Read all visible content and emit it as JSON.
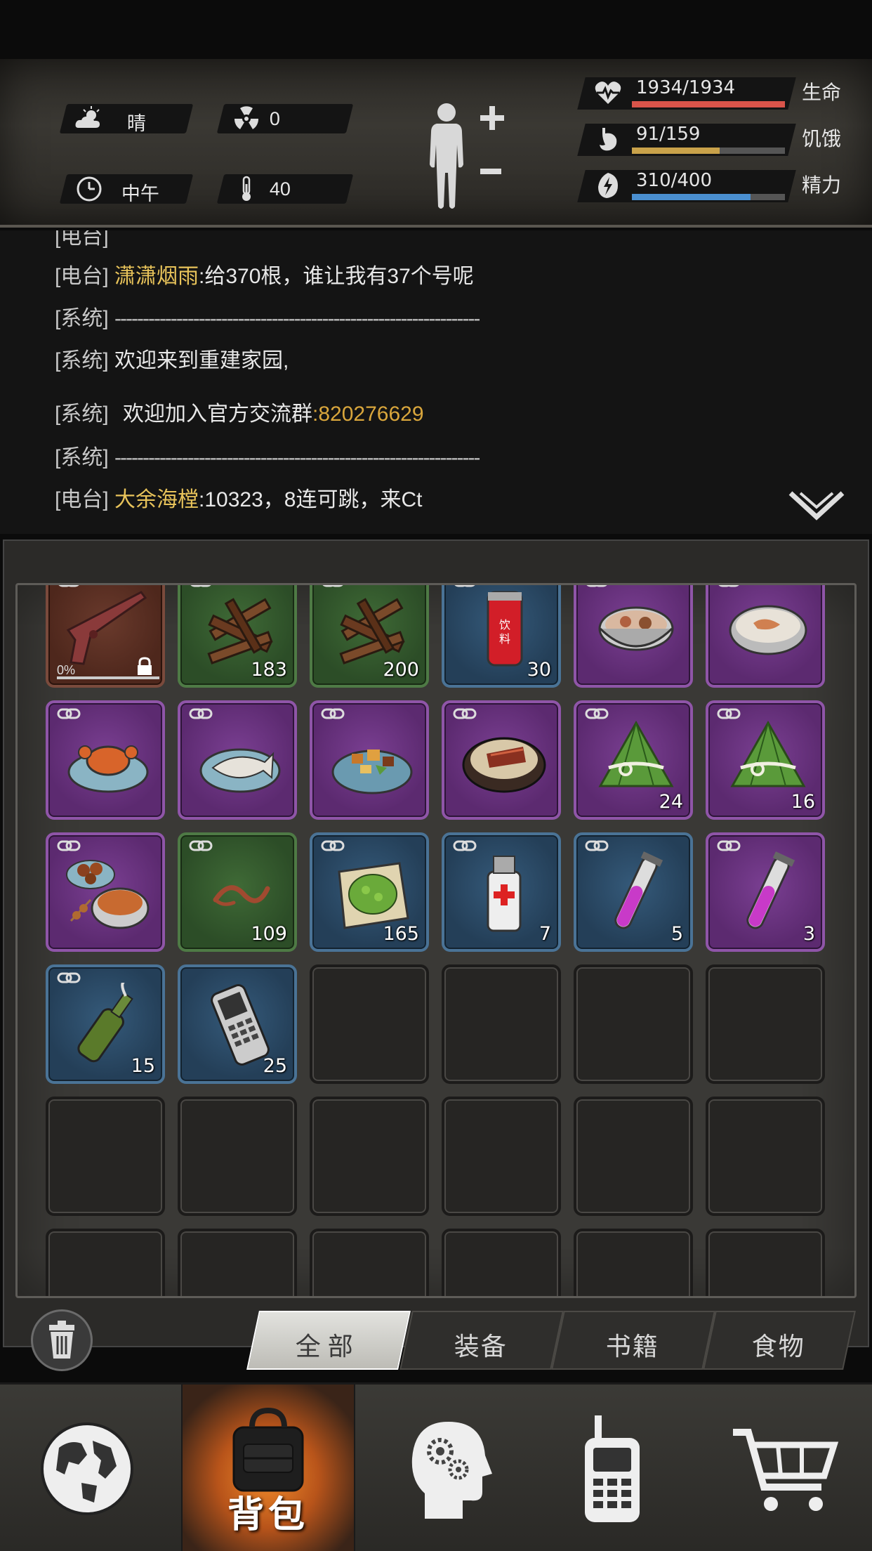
{
  "status": {
    "weather": "晴",
    "radiation": "0",
    "time_of_day": "中午",
    "temperature": "40",
    "stats": [
      {
        "label": "生命",
        "value_text": "1934/1934",
        "current": 1934,
        "max": 1934,
        "color": "#d9544a"
      },
      {
        "label": "饥饿",
        "value_text": "91/159",
        "current": 91,
        "max": 159,
        "color": "#c9a24a"
      },
      {
        "label": "精力",
        "value_text": "310/400",
        "current": 310,
        "max": 400,
        "color": "#4a8fd0"
      }
    ]
  },
  "chat": {
    "lines": [
      {
        "tag": "[电台]",
        "name": "潇潇烟雨",
        "text": ":给370根，谁让我有37个号呢"
      },
      {
        "tag": "[系统]",
        "dashes": "-----------------------------------------------------------------"
      },
      {
        "tag": "[系统]",
        "text": "欢迎来到重建家园,"
      },
      {
        "tag": "[系统]",
        "text": "欢迎加入官方交流群",
        "number": ":820276629"
      },
      {
        "tag": "[系统]",
        "dashes": "-----------------------------------------------------------------"
      },
      {
        "tag": "[电台]",
        "name": "大余海樘",
        "text": ":10323，8连可跳，来Ct"
      }
    ]
  },
  "inventory": {
    "slots": [
      {
        "rarity": "red",
        "item": "shotgun-icon",
        "percent": "0%",
        "locked": true,
        "linked": true
      },
      {
        "rarity": "green",
        "item": "firewood-icon",
        "count": "183",
        "linked": true
      },
      {
        "rarity": "green",
        "item": "firewood-icon",
        "count": "200",
        "linked": true
      },
      {
        "rarity": "blue",
        "item": "drink-can-icon",
        "count": "30",
        "linked": true
      },
      {
        "rarity": "purple",
        "item": "soup-bowl-icon",
        "linked": true
      },
      {
        "rarity": "purple",
        "item": "porridge-bowl-icon",
        "linked": true
      },
      {
        "rarity": "purple",
        "item": "crab-plate-icon",
        "linked": true
      },
      {
        "rarity": "purple",
        "item": "fish-plate-icon",
        "linked": true
      },
      {
        "rarity": "purple",
        "item": "stir-fry-plate-icon",
        "linked": true
      },
      {
        "rarity": "purple",
        "item": "claypot-rice-icon",
        "linked": true
      },
      {
        "rarity": "purple",
        "item": "zongzi-icon",
        "count": "24",
        "linked": true
      },
      {
        "rarity": "purple",
        "item": "zongzi-icon",
        "count": "16",
        "linked": true
      },
      {
        "rarity": "purple",
        "item": "feast-icon",
        "linked": true
      },
      {
        "rarity": "green",
        "item": "worm-icon",
        "count": "109",
        "linked": true
      },
      {
        "rarity": "blue",
        "item": "herb-cloth-icon",
        "count": "165",
        "linked": true
      },
      {
        "rarity": "blue",
        "item": "medical-spray-icon",
        "count": "7",
        "linked": true
      },
      {
        "rarity": "blue",
        "item": "test-tube-icon",
        "count": "5",
        "linked": true
      },
      {
        "rarity": "purple",
        "item": "test-tube-icon",
        "count": "3",
        "linked": true
      },
      {
        "rarity": "blue",
        "item": "molotov-bottle-icon",
        "count": "15",
        "linked": true
      },
      {
        "rarity": "blue",
        "item": "cell-phone-icon",
        "count": "25",
        "linked": false
      }
    ]
  },
  "filter_tabs": [
    {
      "label": "全部",
      "active": true
    },
    {
      "label": "装备",
      "active": false
    },
    {
      "label": "书籍",
      "active": false
    },
    {
      "label": "食物",
      "active": false
    }
  ],
  "nav": {
    "items": [
      {
        "icon": "globe-icon"
      },
      {
        "icon": "backpack-icon",
        "label": "背包",
        "active": true
      },
      {
        "icon": "head-gears-icon"
      },
      {
        "icon": "walkie-talkie-icon"
      },
      {
        "icon": "shopping-cart-icon"
      }
    ]
  }
}
